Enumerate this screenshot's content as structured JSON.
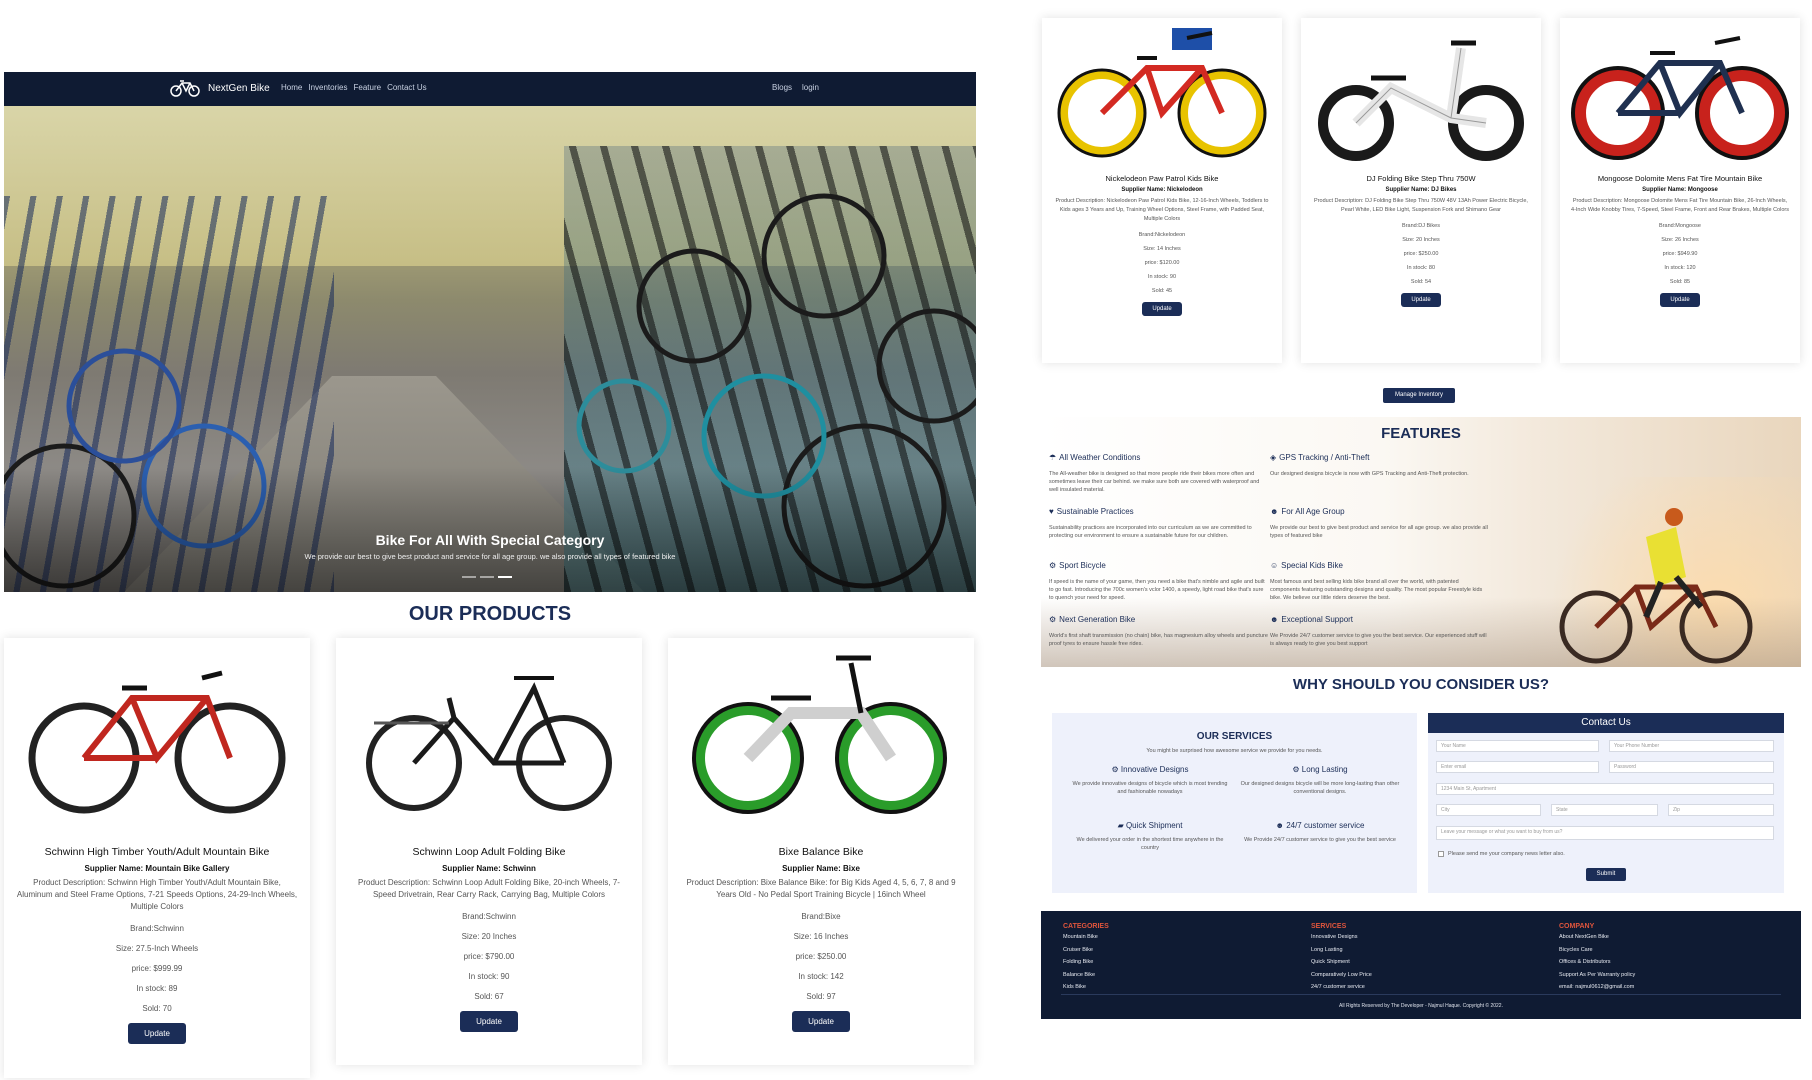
{
  "navbar": {
    "brand": "NextGen Bike",
    "links": [
      "Home",
      "Inventories",
      "Feature",
      "Contact Us"
    ],
    "right_links": [
      "Blogs",
      "login"
    ]
  },
  "hero": {
    "title": "Bike For All With Special Category",
    "subtitle": "We provide our best to give best product and service for all age group. we also provide all types of featured bike"
  },
  "products_title": "OUR PRODUCTS",
  "products": [
    {
      "name": "Schwinn High Timber Youth/Adult Mountain Bike",
      "supplier": "Supplier Name: Mountain Bike Gallery",
      "description": "Product Description: Schwinn High Timber Youth/Adult Mountain Bike, Aluminum and Steel Frame Options, 7-21 Speeds Options, 24-29-Inch Wheels, Multiple Colors",
      "brand": "Brand:Schwinn",
      "size": "Size: 27.5-Inch Wheels",
      "price": "price: $999.99",
      "stock": "In stock: 89",
      "sold": "Sold: 70",
      "button": "Update",
      "frame_color": "#c0271f",
      "wheel_color": "#222222"
    },
    {
      "name": "Schwinn Loop Adult Folding Bike",
      "supplier": "Supplier Name: Schwinn",
      "description": "Product Description: Schwinn Loop Adult Folding Bike, 20-inch Wheels, 7-Speed Drivetrain, Rear Carry Rack, Carrying Bag, Multiple Colors",
      "brand": "Brand:Schwinn",
      "size": "Size: 20 Inches",
      "price": "price: $790.00",
      "stock": "In stock: 90",
      "sold": "Sold: 67",
      "button": "Update",
      "frame_color": "#1a1a1a",
      "wheel_color": "#222222"
    },
    {
      "name": "Bixe Balance Bike",
      "supplier": "Supplier Name: Bixe",
      "description": "Product Description: Bixe Balance Bike: for Big Kids Aged 4, 5, 6, 7, 8 and 9 Years Old - No Pedal Sport Training Bicycle | 16inch Wheel",
      "brand": "Brand:Bixe",
      "size": "Size: 16 Inches",
      "price": "price: $250.00",
      "stock": "In stock: 142",
      "sold": "Sold: 97",
      "button": "Update",
      "frame_color": "#eeeeee",
      "wheel_color": "#2a9c2a"
    },
    {
      "name": "Nickelodeon Paw Patrol Kids Bike",
      "supplier": "Supplier Name: Nickelodeon",
      "description": "Product Description: Nickelodeon Paw Patrol Kids Bike, 12-16-Inch Wheels, Toddlers to Kids ages 3 Years and Up, Training Wheel Options, Steel Frame, with Padded Seat, Multiple Colors",
      "brand": "Brand:Nickelodeon",
      "size": "Size: 14 Inches",
      "price": "price: $120.00",
      "stock": "In stock: 90",
      "sold": "Sold: 45",
      "button": "Update",
      "frame_color": "#d32a22",
      "wheel_color": "#e8c300"
    },
    {
      "name": "DJ Folding Bike Step Thru 750W",
      "supplier": "Supplier Name: DJ Bikes",
      "description": "Product Description: DJ Folding Bike Step Thru 750W 48V 13Ah Power Electric Bicycle, Pearl White, LED Bike Light, Suspension Fork and Shimano Gear",
      "brand": "Brand:DJ Bikes",
      "size": "Size: 20 Inches",
      "price": "price: $250.00",
      "stock": "In stock: 80",
      "sold": "Sold: 54",
      "button": "Update",
      "frame_color": "#f2f2f2",
      "wheel_color": "#1a1a1a"
    },
    {
      "name": "Mongoose Dolomite Mens Fat Tire Mountain Bike",
      "supplier": "Supplier Name: Mongoose",
      "description": "Product Description: Mongoose Dolomite Mens Fat Tire Mountain Bike, 26-Inch Wheels, 4-Inch Wide Knobby Tires, 7-Speed, Steel Frame, Front and Rear Brakes, Multiple Colors",
      "brand": "Brand:Mongoose",
      "size": "Size: 26 Inches",
      "price": "price: $949.90",
      "stock": "In stock: 120",
      "sold": "Sold: 85",
      "button": "Update",
      "frame_color": "#1f3050",
      "wheel_color": "#c8221c"
    }
  ],
  "manage_inventory_label": "Manage Inventory",
  "features": {
    "title": "FEATURES",
    "items": [
      {
        "title": "All Weather Conditions",
        "icon": "umbrella-icon",
        "text": "The All-weather bike is designed so that more people ride their bikes more often and sometimes leave their car behind. we make sure both are covered with waterproof and well insulated material."
      },
      {
        "title": "GPS Tracking / Anti-Theft",
        "icon": "location-icon",
        "text": "Our designed designs bicycle is now with GPS Tracking and Anti-Theft protection."
      },
      {
        "title": "Sustainable Practices",
        "icon": "heart-icon",
        "text": "Sustainability practices are incorporated into our curriculum as we are committed to protecting our environment to ensure a sustainable future for our children."
      },
      {
        "title": "For All Age Group",
        "icon": "users-icon",
        "text": "We provide our best to give best product and service for all age group. we also provide all types of featured bike"
      },
      {
        "title": "Sport Bicycle",
        "icon": "bicycle-icon",
        "text": "If speed is the name of your game, then you need a bike that's nimble and agile and built to go fast. Introducing the 700c women's vclor 1400, a speedy, light road bike that's sure to quench your need for speed."
      },
      {
        "title": "Special Kids Bike",
        "icon": "children-icon",
        "text": "Most famous and best selling kids bike brand all over the world, with patented components featuring outstanding designs and quality. The most popular Freestyle kids bike. We believe our little riders deserve the best."
      },
      {
        "title": "Next Generation Bike",
        "icon": "bicycle-icon",
        "text": "World's first shaft transmission (no chain) bike, has magnesium alloy wheels and puncture proof tyres to ensure hassle free rides."
      },
      {
        "title": "Exceptional Support",
        "icon": "users-icon",
        "text": "We Provide 24/7 customer service to give you the best service. Our experienced stuff will is always ready to give you best support"
      }
    ]
  },
  "why_title": "WHY SHOULD YOU CONSIDER US?",
  "services": {
    "title": "OUR SERVICES",
    "subtitle": "You might be surprised how awesome service we provide for you needs.",
    "items": [
      {
        "title": "Innovative Designs",
        "icon": "bicycle-icon",
        "text": "We provide innovative designs of bicycle which is most trending and fashionable nowadays"
      },
      {
        "title": "Long Lasting",
        "icon": "gears-icon",
        "text": "Our designed designs bicycle will be more long-lasting than other conventional designs."
      },
      {
        "title": "Quick Shipment",
        "icon": "truck-icon",
        "text": "We delivered your order in the shortest time anywhere in the country"
      },
      {
        "title": "24/7 customer service",
        "icon": "users-icon",
        "text": "We Provide 24/7 customer service to give you the best service"
      }
    ]
  },
  "contact": {
    "title": "Contact Us",
    "name_placeholder": "Your Name",
    "phone_placeholder": "Your Phone Number",
    "email_placeholder": "Enter email",
    "password_placeholder": "Password",
    "address_placeholder": "1234 Main St, Apartment",
    "city_placeholder": "City",
    "state_placeholder": "State",
    "zip_placeholder": "Zip",
    "message_placeholder": "Leave your message or what you want to buy from us?",
    "newsletter_label": "Please send me your company news letter also.",
    "submit_label": "Submit"
  },
  "footer": {
    "columns": [
      {
        "title": "CATEGORIES",
        "links": [
          "Mountain Bike",
          "Cruiser Bike",
          "Folding Bike",
          "Balance Bike",
          "Kids Bike"
        ]
      },
      {
        "title": "SERVICES",
        "links": [
          "Innovative Designs",
          "Long Lasting",
          "Quick Shipment",
          "Comparatively Low Price",
          "24/7 customer service"
        ]
      },
      {
        "title": "COMPANY",
        "links": [
          "About NextGen Bike",
          "Bicycles Care",
          "Offices & Distributors",
          "Support As Per Warranty policy",
          "email: najmul0612@gmail.com"
        ]
      }
    ],
    "copyright": "All Rights Reserved by The Developer - Najmul Haque. Copyright © 2022."
  },
  "colors": {
    "navy": "#0f1b33",
    "accent": "#1b2d57",
    "footer_heading": "#e0553c"
  }
}
